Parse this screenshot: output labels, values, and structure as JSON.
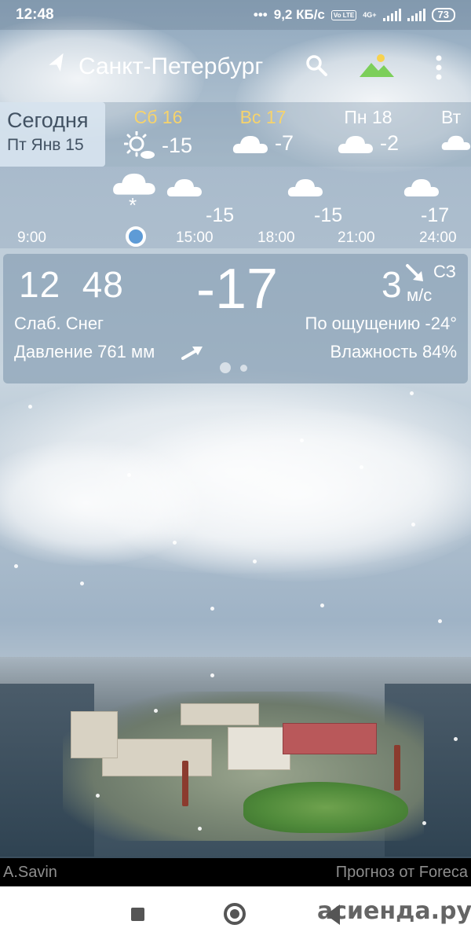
{
  "status_bar": {
    "time": "12:48",
    "dots": "•••",
    "speed": "9,2 КБ/с",
    "volte": "Vo LTE",
    "network": "4G+",
    "battery": "73"
  },
  "app_bar": {
    "city": "Санкт-Петербург",
    "icons": [
      "location-arrow-icon",
      "search-icon",
      "landscape-icon",
      "more-menu-icon"
    ]
  },
  "days": {
    "today": {
      "label": "Сегодня",
      "date": "Пт Янв 15"
    },
    "items": [
      {
        "name": "Сб 16",
        "temp": "-15",
        "icon": "sun-cloud-icon",
        "weekend": true
      },
      {
        "name": "Вс 17",
        "temp": "-7",
        "icon": "cloud-icon",
        "weekend": true
      },
      {
        "name": "Пн 18",
        "temp": "-2",
        "icon": "cloud-icon",
        "weekend": false
      },
      {
        "name": "Вт",
        "temp": "",
        "icon": "cloud-icon",
        "weekend": false
      }
    ]
  },
  "hourly": {
    "temps": [
      "-15",
      "-15",
      "-17"
    ],
    "times": [
      "9:00",
      "15:00",
      "18:00",
      "21:00",
      "24:00"
    ],
    "snow_symbol": "*"
  },
  "current": {
    "time": "12  48",
    "temp": "-17",
    "wind_speed": "3",
    "wind_dir": "СЗ",
    "wind_unit": "м/с",
    "condition": "Слаб. Снег",
    "feels_like": "По ощущению -24°",
    "pressure": "Давление 761 мм",
    "humidity": "Влажность 84%"
  },
  "credits": {
    "photo": "A.Savin",
    "provider": "Прогноз от Foreca"
  },
  "watermark": "асиенда.ру",
  "colors": {
    "weekend": "#f6d36c",
    "today_bg": "#dce8f2",
    "today_text": "#425263",
    "now_dot": "#5e9bd6"
  }
}
